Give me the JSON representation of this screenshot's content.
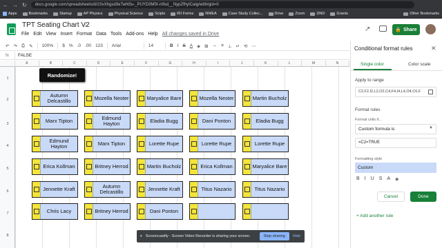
{
  "browser": {
    "url": "docs.google.com/spreadsheets/d/1SvXhgsd3eTwN5u-_PUYD3MfX-n9sd__NypZfhyICalg/edit#gid=0",
    "bookmarks": [
      "Apps",
      "Bookmarks",
      "Startup",
      "AP Physics",
      "Physical Science",
      "Scipts",
      "RII Forms",
      "NWEA",
      "Case Study Collec...",
      "Drive",
      "Zoom",
      "DND",
      "Grants"
    ],
    "other_bookmarks": "Other Bookmarks"
  },
  "doc": {
    "title": "TPT Seating Chart V2",
    "star": "☆",
    "menus": [
      "File",
      "Edit",
      "View",
      "Insert",
      "Format",
      "Data",
      "Tools",
      "Add-ons",
      "Help"
    ],
    "saved": "All changes saved in Drive",
    "share": "Share"
  },
  "toolbar": {
    "zoom": "100%",
    "currency": "$",
    "percent": "%",
    ".0": ".0",
    ".00": ".00",
    "format123": "123",
    "font": "Arial",
    "size": "14",
    "bold": "B",
    "italic": "I",
    "strike": "S",
    "textcolor": "A"
  },
  "formula": {
    "fx": "fx",
    "value": "FALSE"
  },
  "grid": {
    "columns": [
      "A",
      "B",
      "C",
      "D",
      "E",
      "F",
      "G",
      "H",
      "I",
      "J",
      "K",
      "L",
      "M",
      "N"
    ],
    "rows": [
      "1",
      "2",
      "3",
      "4",
      "5",
      "6",
      "7",
      "8"
    ]
  },
  "randomize": "Randomize!",
  "seats": [
    [
      "Autumn Delcastillo",
      "Mozella Nester",
      "Maryalice Bare",
      "Mozella Nester",
      "Martin Bucholz"
    ],
    [
      "Marx Tipton",
      "Edmund Hayton",
      "Eladia Bugg",
      "Dani Ponton",
      "Eladia Bugg"
    ],
    [
      "Edmund Hayton",
      "Marx Tipton",
      "Lorette Rupe",
      "Lorette Rupe",
      "Lorette Rupe"
    ],
    [
      "Erica Kollman",
      "Britney Herrod",
      "Martin Bucholz",
      "Erica Kollman",
      "Maryalice Bare"
    ],
    [
      "Jennette Kraft",
      "Autumn Delcastillo",
      "Jennette Kraft",
      "Titus Nazario",
      "Titus Nazario"
    ],
    [
      "Chris Lacy",
      "Britney Herrod",
      "Dani Ponton",
      "",
      ""
    ]
  ],
  "panel": {
    "title": "Conditional format rules",
    "close": "✕",
    "tab_single": "Single color",
    "tab_scale": "Color scale",
    "apply_label": "Apply to range",
    "range": "C2,F2,I2,L2,O2,C4,F4,I4,L4,O4,C6,F",
    "rules_label": "Format rules",
    "if_label": "Format cells if...",
    "condition": "Custom formula is",
    "formula": "=C2=TRUE",
    "style_label": "Formatting style",
    "style_name": "Custom",
    "style_icons": [
      "B",
      "I",
      "U",
      "S",
      "A",
      "◈"
    ],
    "cancel": "Cancel",
    "done": "Done",
    "add_rule": "+ Add another rule",
    "colors": {
      "accent": "#188038",
      "style_bg": "#c9daf8"
    }
  },
  "cast": {
    "icon": "⏸",
    "message": "Screencastify - Screen Video Recorder is sharing your screen.",
    "stop": "Stop sharing",
    "hide": "Hide"
  }
}
